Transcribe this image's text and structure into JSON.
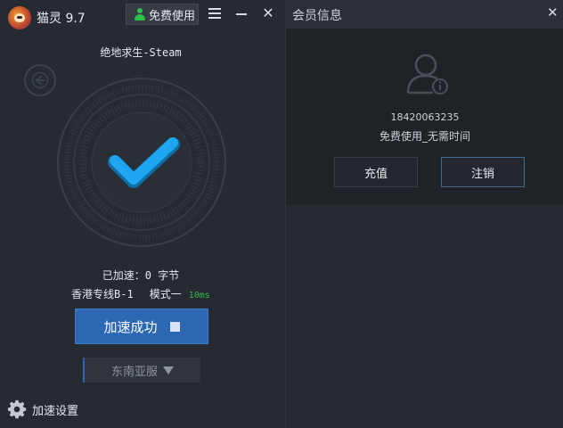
{
  "app": {
    "name": "猫灵 9.7",
    "free_label": "免费使用"
  },
  "main": {
    "game_title": "绝地求生-Steam",
    "accel_status": "已加速：0 字节",
    "route_name": "香港专线B-1",
    "mode": "模式一",
    "ping": "10ms",
    "accel_button_label": "加速成功",
    "region_label": "东南亚服",
    "settings_label": "加速设置"
  },
  "member": {
    "title": "会员信息",
    "phone": "18420063235",
    "plan": "免费使用_无需时间",
    "recharge_label": "充值",
    "logout_label": "注销"
  },
  "colors": {
    "accent_blue": "#2c67b4",
    "check_blue": "#1ea7f0",
    "ping_green": "#2ebf4b",
    "panel_bg": "#262a31"
  },
  "icons": [
    "app-logo",
    "user-icon",
    "menu-icon",
    "minimize-icon",
    "close-icon",
    "back-icon",
    "check-icon",
    "stop-icon",
    "triangle-down-icon",
    "gear-icon",
    "avatar-icon"
  ]
}
